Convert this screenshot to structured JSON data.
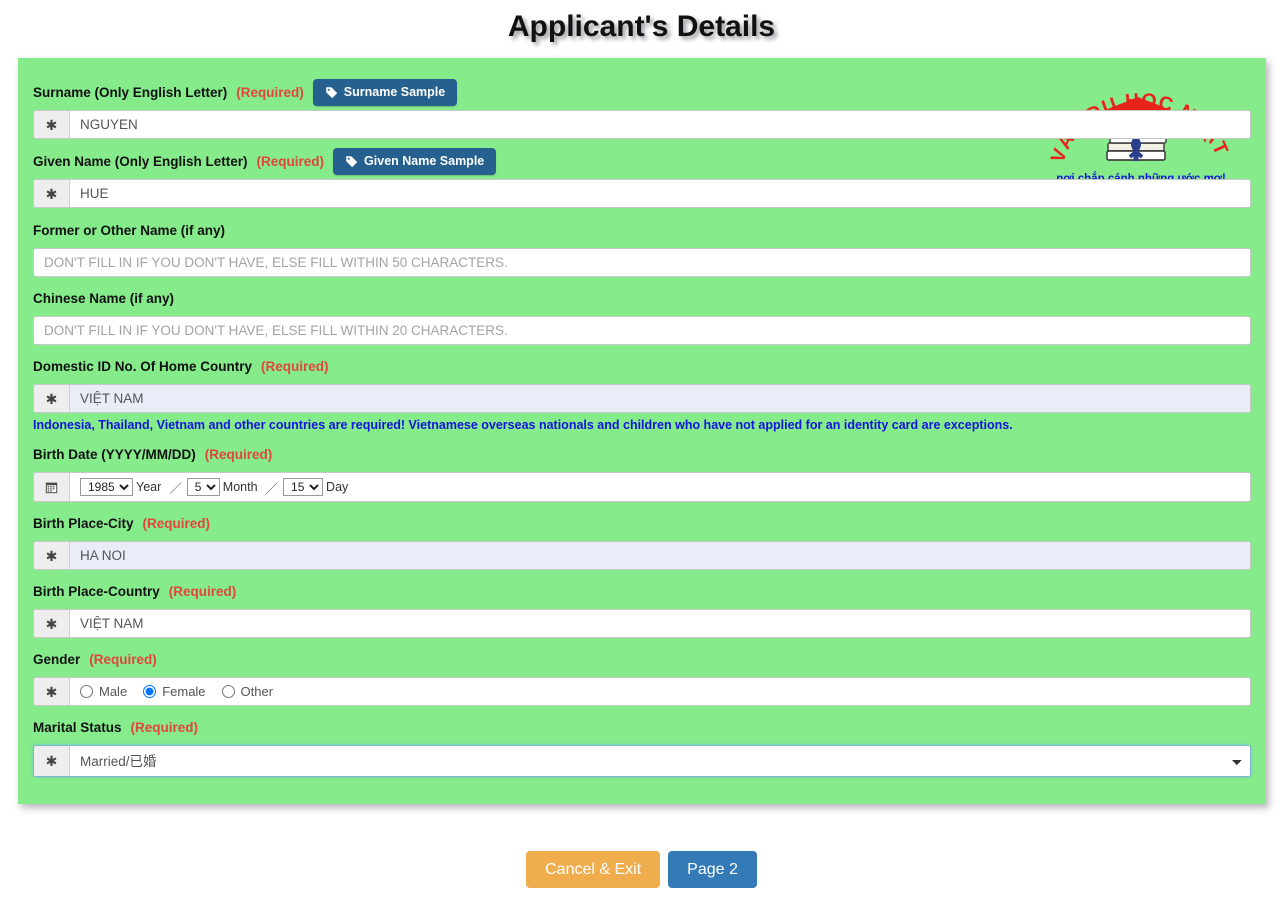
{
  "page": {
    "title": "Applicant's Details"
  },
  "logo": {
    "arc_text": "TƯ VẤN DU HỌC NHẬT ĐẠI",
    "tagline": "nơi chắp cánh những ước mơ!",
    "alt": "logo"
  },
  "form": {
    "required_tag": "(Required)",
    "addon_icon": "asterisk-icon",
    "calendar_icon": "calendar-icon",
    "fields": {
      "surname": {
        "label": "Surname (Only English Letter)",
        "required": "(Required)",
        "sample_button": "Surname Sample",
        "value": "NGUYEN"
      },
      "given_name": {
        "label": "Given Name (Only English Letter)",
        "required": "(Required)",
        "sample_button": "Given Name Sample",
        "value": "HUE"
      },
      "former_name": {
        "label": "Former or Other Name (if any)",
        "placeholder": "DON'T FILL IN IF YOU DON'T HAVE, ELSE FILL WITHIN 50 CHARACTERS.",
        "value": ""
      },
      "chinese_name": {
        "label": "Chinese Name (if any)",
        "placeholder": "DON'T FILL IN IF YOU DON'T HAVE, ELSE FILL WITHIN 20 CHARACTERS.",
        "value": ""
      },
      "domestic_id": {
        "label": "Domestic ID No. Of Home Country",
        "required": "(Required)",
        "value": "VIỆT NAM",
        "note": "Indonesia, Thailand, Vietnam and other countries are required! Vietnamese overseas nationals and children who have not applied for an identity card are exceptions."
      },
      "birth_date": {
        "label": "Birth Date (YYYY/MM/DD)",
        "required": "(Required)",
        "year": "1985",
        "year_unit": "Year",
        "month": "5",
        "month_unit": "Month",
        "day": "15",
        "day_unit": "Day",
        "separator": "／"
      },
      "birth_city": {
        "label": "Birth Place-City",
        "required": "(Required)",
        "value": "HA NOI"
      },
      "birth_country": {
        "label": "Birth Place-Country",
        "required": "(Required)",
        "value": "VIỆT NAM"
      },
      "gender": {
        "label": "Gender",
        "required": "(Required)",
        "options": [
          "Male",
          "Female",
          "Other"
        ],
        "selected": "Female"
      },
      "marital_status": {
        "label": "Marital Status",
        "required": "(Required)",
        "selected": "Married/已婚"
      }
    }
  },
  "footer": {
    "cancel_label": "Cancel & Exit",
    "next_label": "Page 2"
  },
  "colors": {
    "panel_green": "#85eb8b",
    "required_red": "#e2453c",
    "note_blue": "#1414e0",
    "sample_button_blue": "#26608e",
    "cancel_orange": "#f0ad4e",
    "next_blue": "#337ab7",
    "autofill_blue": "#e8edf8"
  }
}
